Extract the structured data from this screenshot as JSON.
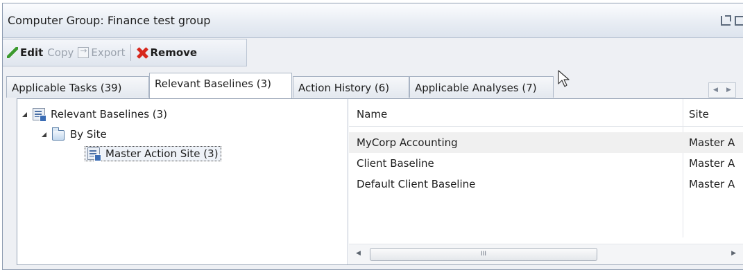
{
  "window": {
    "title": "Computer Group: Finance test group"
  },
  "toolbar": {
    "edit_label": "Edit",
    "copy_label": "Copy",
    "export_label": "Export",
    "remove_label": "Remove"
  },
  "tabs": [
    {
      "label": "Applicable Tasks (39)"
    },
    {
      "label": "Relevant Baselines (3)"
    },
    {
      "label": "Action History (6)"
    },
    {
      "label": "Applicable Analyses (7)"
    }
  ],
  "tree": {
    "root": "Relevant Baselines (3)",
    "group": "By Site",
    "leaf": "Master Action Site (3)"
  },
  "list": {
    "columns": [
      "Name",
      "Site"
    ],
    "rows": [
      {
        "name": "MyCorp Accounting",
        "site": "Master A"
      },
      {
        "name": "Client Baseline",
        "site": "Master A"
      },
      {
        "name": "Default Client Baseline",
        "site": "Master A"
      }
    ],
    "scroll_grip": "III"
  },
  "icons": {
    "edit": "pencil-icon",
    "export": "export-icon",
    "remove": "remove-icon",
    "baseline": "baseline-icon",
    "folder": "folder-icon"
  },
  "colors": {
    "remove_accent": "#d7281d",
    "edit_accent": "#3c9a2e"
  }
}
